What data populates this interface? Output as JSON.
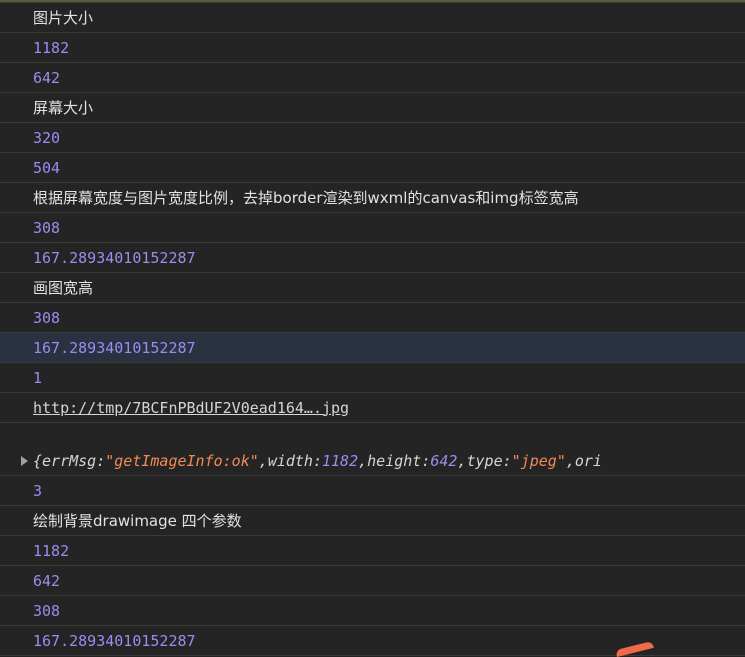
{
  "console": {
    "rows": [
      {
        "kind": "text",
        "value": "图片大小"
      },
      {
        "kind": "num",
        "value": "1182"
      },
      {
        "kind": "num",
        "value": "642"
      },
      {
        "kind": "text",
        "value": "屏幕大小"
      },
      {
        "kind": "num",
        "value": "320"
      },
      {
        "kind": "num",
        "value": "504"
      },
      {
        "kind": "text",
        "value": "根据屏幕宽度与图片宽度比例，去掉border渲染到wxml的canvas和img标签宽高"
      },
      {
        "kind": "num",
        "value": "308"
      },
      {
        "kind": "num",
        "value": "167.28934010152287"
      },
      {
        "kind": "text",
        "value": "画图宽高"
      },
      {
        "kind": "num",
        "value": "308"
      },
      {
        "kind": "num",
        "value": "167.28934010152287"
      },
      {
        "kind": "num",
        "value": "1"
      },
      {
        "kind": "link",
        "value": "http://tmp/7BCFnPBdUF2V0ead164….jpg"
      },
      {
        "kind": "object"
      },
      {
        "kind": "num",
        "value": "3"
      },
      {
        "kind": "text",
        "value": "绘制背景drawimage 四个参数"
      },
      {
        "kind": "num",
        "value": "1182"
      },
      {
        "kind": "num",
        "value": "642"
      },
      {
        "kind": "num",
        "value": "308"
      },
      {
        "kind": "num",
        "value": "167.28934010152287"
      }
    ],
    "object": {
      "open": "{",
      "k1": "errMsg: ",
      "v1": "\"getImageInfo:ok\"",
      "sep1": ", ",
      "k2": "width: ",
      "v2": "1182",
      "sep2": ", ",
      "k3": "height: ",
      "v3": "642",
      "sep3": ", ",
      "k4": "type: ",
      "v4": "\"jpeg\"",
      "sep4": ", ",
      "k5": "ori"
    }
  }
}
